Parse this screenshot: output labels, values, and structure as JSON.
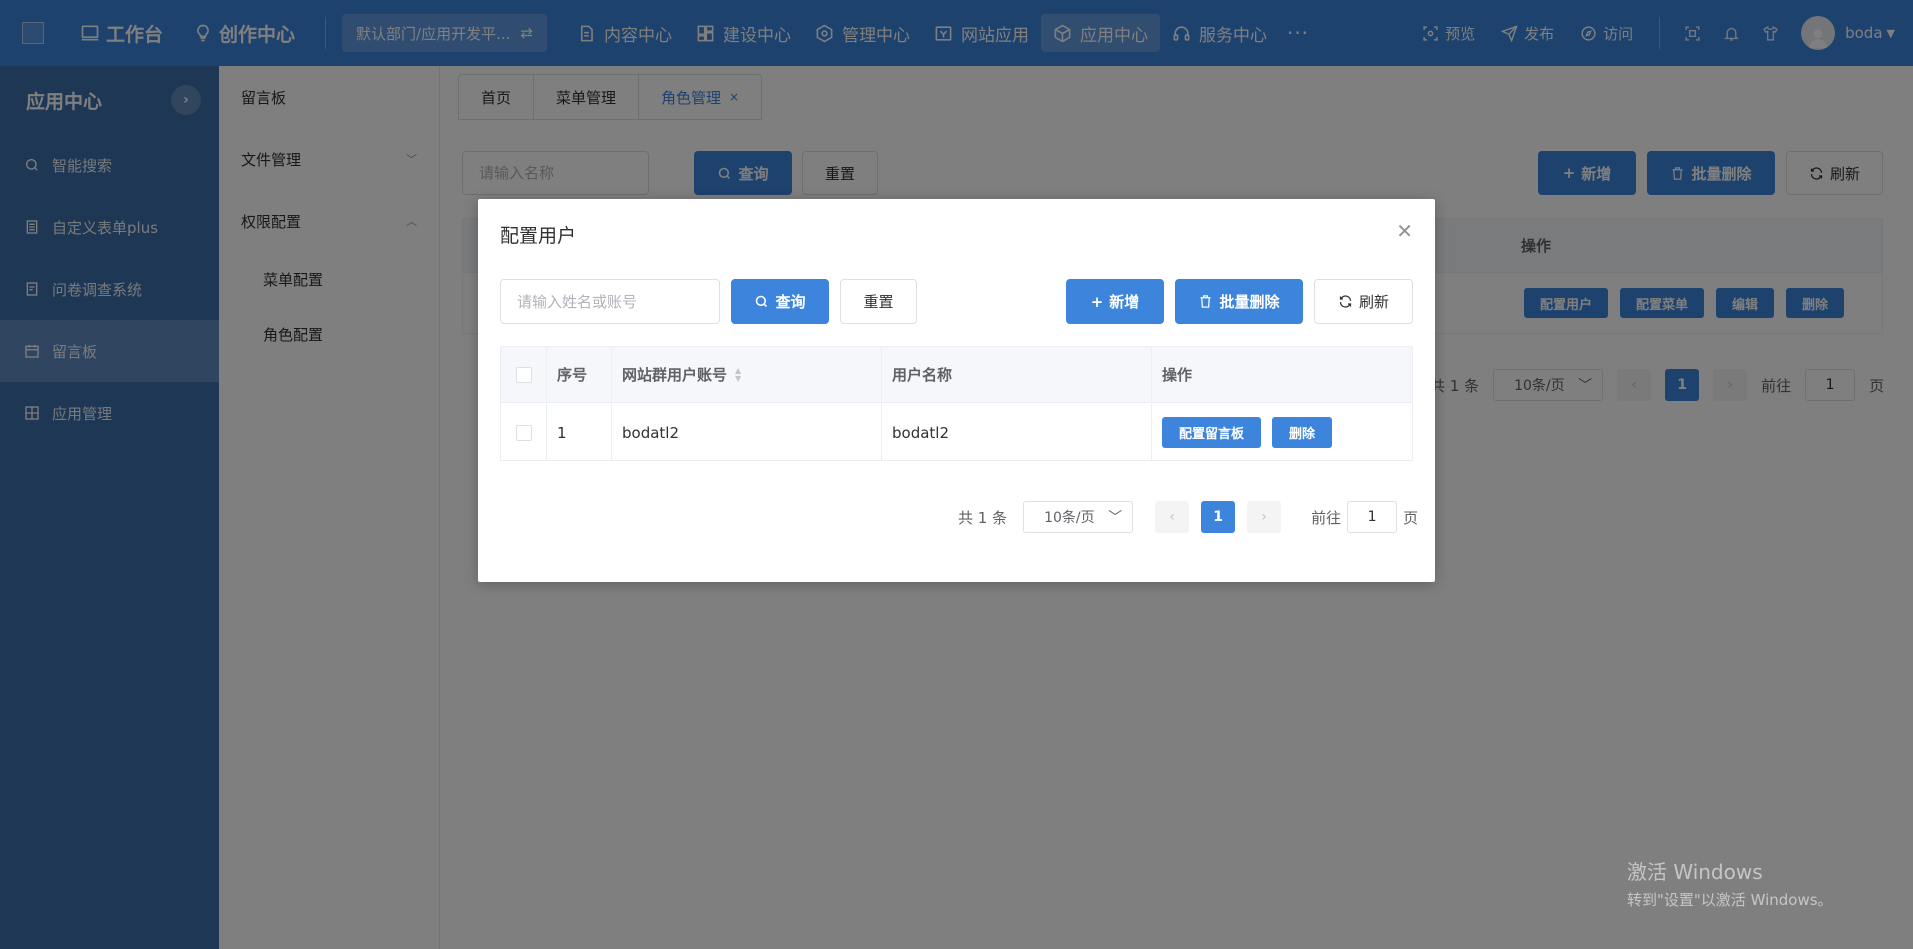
{
  "topbar": {
    "workbench": "工作台",
    "creation": "创作中心",
    "dept": "默认部门/应用开发平...",
    "nav": [
      "内容中心",
      "建设中心",
      "管理中心",
      "网站应用",
      "应用中心",
      "服务中心"
    ],
    "more": "···",
    "preview": "预览",
    "publish": "发布",
    "visit": "访问",
    "user": "boda"
  },
  "sidebar": {
    "title": "应用中心",
    "items": [
      "智能搜索",
      "自定义表单plus",
      "问卷调查系统",
      "留言板",
      "应用管理"
    ]
  },
  "subnav": {
    "items": [
      "留言板",
      "文件管理",
      "权限配置"
    ],
    "sub_items": [
      "菜单配置",
      "角色配置"
    ]
  },
  "tabs": [
    "首页",
    "菜单管理",
    "角色管理"
  ],
  "bg": {
    "search_placeholder": "请输入名称",
    "query": "查询",
    "reset": "重置",
    "add": "新增",
    "batch_delete": "批量删除",
    "refresh": "刷新",
    "col_ops": "操作",
    "row_actions": [
      "配置用户",
      "配置菜单",
      "编辑",
      "删除"
    ],
    "total": "共 1 条",
    "page_size": "10条/页",
    "page": "1",
    "goto": "前往",
    "goto_value": "1",
    "page_unit": "页"
  },
  "dialog": {
    "title": "配置用户",
    "search_placeholder": "请输入姓名或账号",
    "query": "查询",
    "reset": "重置",
    "add": "新增",
    "batch_delete": "批量删除",
    "refresh": "刷新",
    "columns": [
      "序号",
      "网站群用户账号",
      "用户名称",
      "操作"
    ],
    "rows": [
      {
        "index": "1",
        "account": "bodatl2",
        "name": "bodatl2",
        "actions": [
          "配置留言板",
          "删除"
        ]
      }
    ],
    "pager": {
      "total": "共 1 条",
      "page_size": "10条/页",
      "page": "1",
      "goto": "前往",
      "goto_value": "1",
      "page_unit": "页"
    }
  },
  "watermark": {
    "line1": "激活 Windows",
    "line2": "转到\"设置\"以激活 Windows。"
  },
  "colors": {
    "primary": "#3d85dc",
    "sidebar": "#3c6ea8",
    "overlay": "rgba(0,0,0,0.5)"
  }
}
